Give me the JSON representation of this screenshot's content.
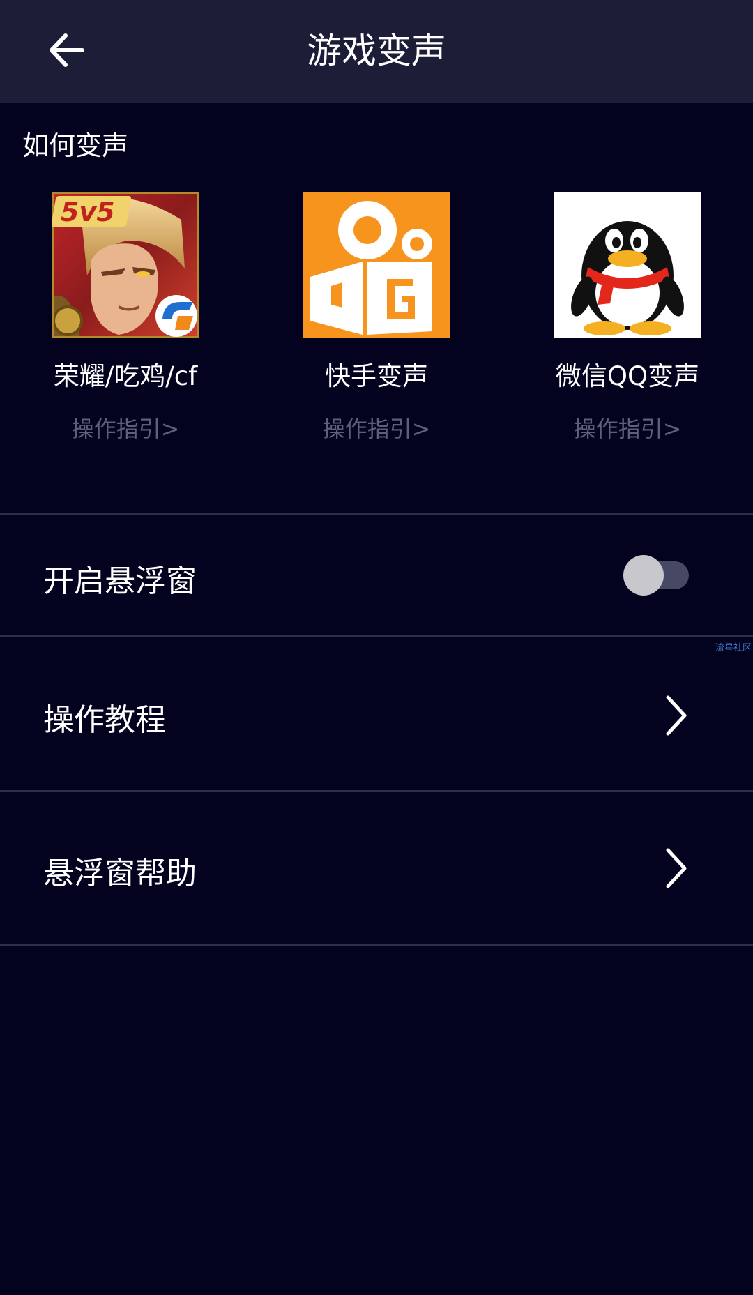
{
  "header": {
    "title": "游戏变声",
    "back_icon": "arrow-left-icon"
  },
  "section": {
    "title": "如何变声"
  },
  "apps": [
    {
      "name": "荣耀/吃鸡/cf",
      "guide": "操作指引>",
      "icon": "honor-of-kings-game-icon"
    },
    {
      "name": "快手变声",
      "guide": "操作指引>",
      "icon": "kuaishou-app-icon"
    },
    {
      "name": "微信QQ变声",
      "guide": "操作指引>",
      "icon": "qq-penguin-icon"
    }
  ],
  "settings": {
    "floating_window": {
      "label": "开启悬浮窗",
      "enabled": false
    },
    "tutorial": {
      "label": "操作教程"
    },
    "help": {
      "label": "悬浮窗帮助"
    }
  },
  "watermark": "流星社区",
  "colors": {
    "background": "#03031f",
    "header": "#1c1d36",
    "guide_text": "#5e5f78",
    "divider": "#2d2f48",
    "kuaishou_orange": "#f7941d"
  }
}
